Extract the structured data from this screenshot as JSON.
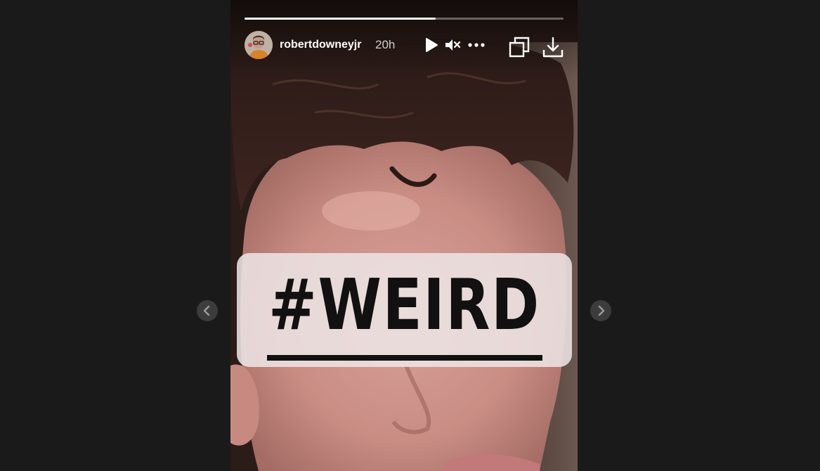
{
  "story": {
    "username": "robertdowneyjr",
    "time_ago": "20h",
    "progress_fraction": 0.6,
    "sticker_text": "#WEIRD"
  },
  "icons": {
    "play": "play-icon",
    "mute": "volume-muted-icon",
    "more": "more-options-icon",
    "copy": "copy-icon",
    "download": "download-icon",
    "prev": "chevron-left-icon",
    "next": "chevron-right-icon"
  },
  "colors": {
    "background": "#1a1a1a",
    "progress_track": "#ffffff59",
    "progress_fill": "#ffffff",
    "nav_button": "#3c3c3c",
    "sticker_bg": "#ece4e4",
    "sticker_text": "#111111"
  }
}
